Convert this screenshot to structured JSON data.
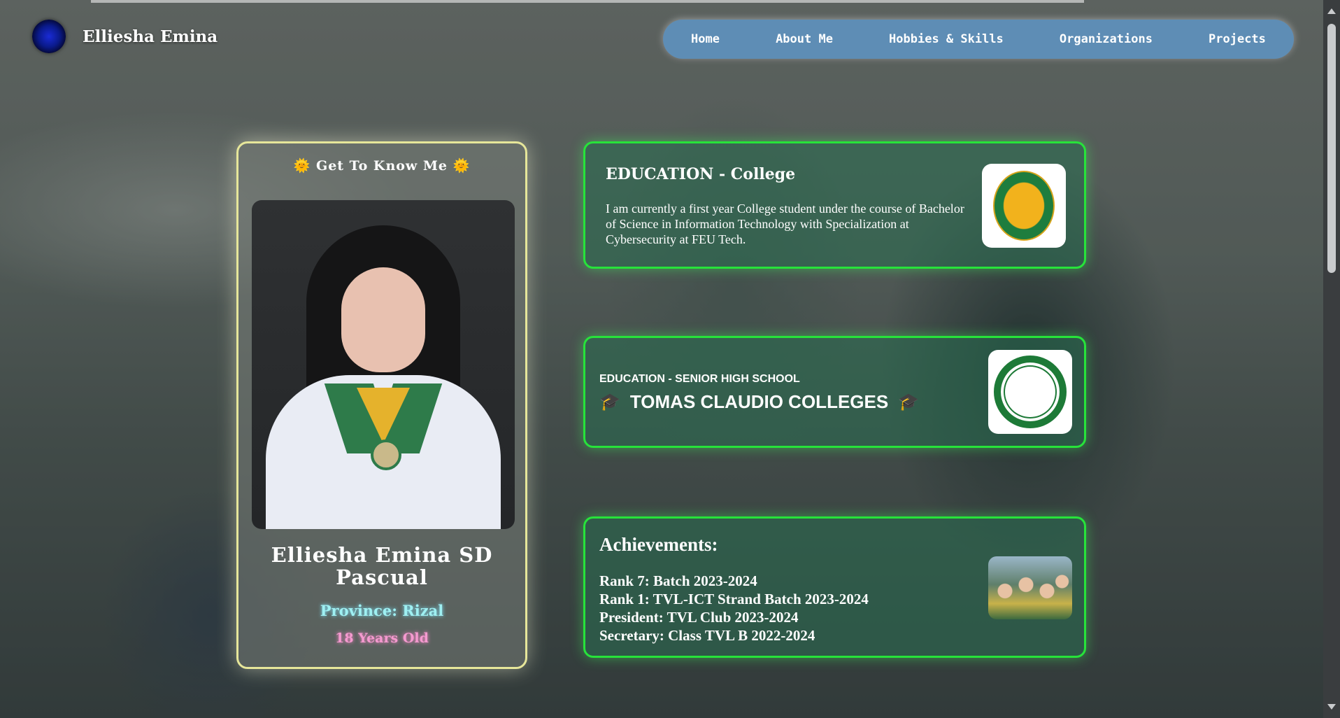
{
  "header": {
    "brand_name": "Elliesha Emina",
    "logo_icon": "rose-icon"
  },
  "nav": {
    "items": [
      {
        "label": "Home"
      },
      {
        "label": "About Me"
      },
      {
        "label": "Hobbies & Skills"
      },
      {
        "label": "Organizations"
      },
      {
        "label": "Projects"
      }
    ]
  },
  "profile": {
    "heading": "🌞 Get To Know Me 🌞",
    "name": "Elliesha Emina SD Pascual",
    "province": "Province: Rizal",
    "age": "18 Years Old"
  },
  "college": {
    "title": "EDUCATION - College",
    "text": "I am currently a first year College student under the course of Bachelor of Science in Information Technology with Specialization at Cybersecurity at FEU Tech."
  },
  "shs": {
    "label": "EDUCATION - SENIOR HIGH SCHOOL",
    "school": "TOMAS CLAUDIO COLLEGES",
    "cap": "🎓"
  },
  "achievements": {
    "title": "Achievements:",
    "items": [
      "Rank 7: Batch 2023-2024",
      "Rank 1: TVL-ICT Strand Batch 2023-2024",
      "President: TVL Club 2023-2024",
      "Secretary: Class TVL B 2022-2024"
    ]
  },
  "colors": {
    "nav_bg": "#5e8db5",
    "card_border": "#27e33a",
    "profile_border": "#e6e69a",
    "province": "#9ff0f2",
    "age": "#f59ad0"
  }
}
